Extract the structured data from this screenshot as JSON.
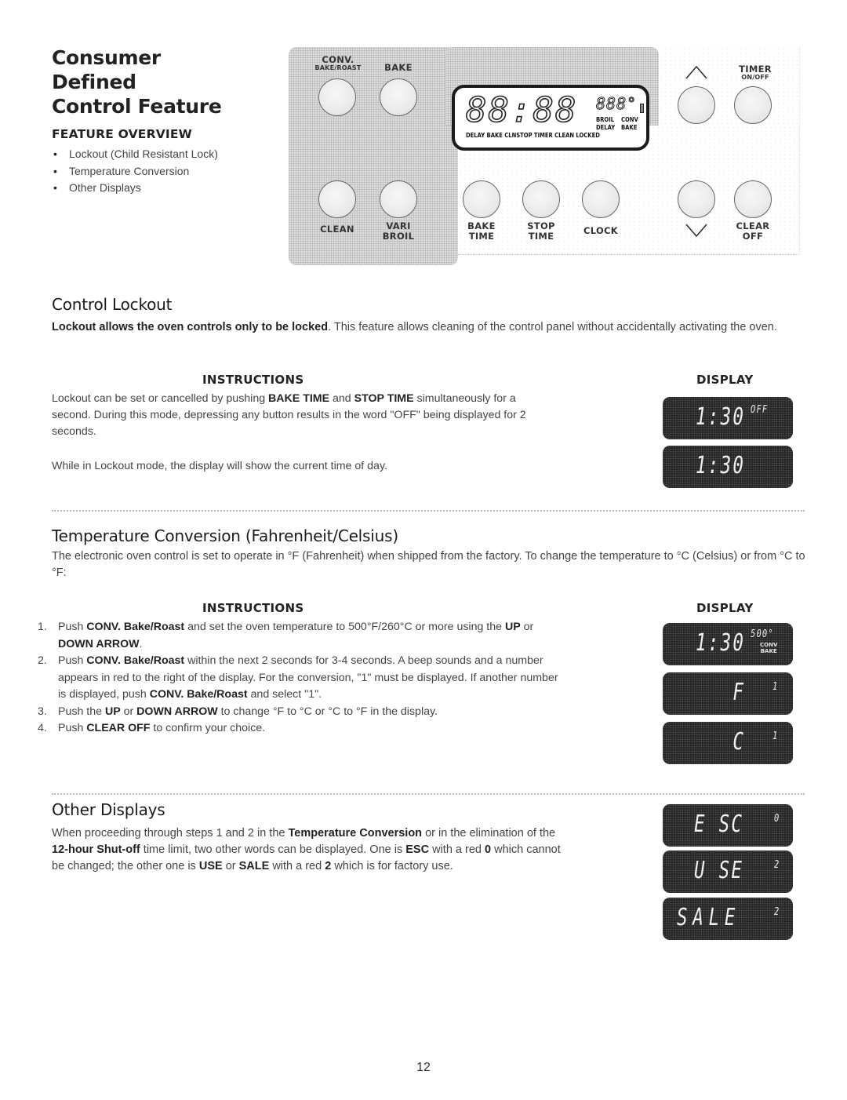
{
  "header": {
    "title_lines": [
      "Consumer",
      "Defined",
      "Control Feature"
    ],
    "overview_heading": "FEATURE OVERVIEW",
    "overview_items": [
      "Lockout (Child Resistant Lock)",
      "Temperature Conversion",
      "Other Displays"
    ]
  },
  "control_panel": {
    "buttons": {
      "conv_bake_roast": {
        "line1": "CONV.",
        "line2": "BAKE/ROAST"
      },
      "bake": {
        "line1": "BAKE"
      },
      "clean": {
        "line1": "CLEAN"
      },
      "vari_broil": {
        "line1": "VARI",
        "line2": "BROIL"
      },
      "bake_time": {
        "line1": "BAKE",
        "line2": "TIME"
      },
      "stop_time": {
        "line1": "STOP",
        "line2": "TIME"
      },
      "clock": {
        "line1": "CLOCK"
      },
      "up_arrow": {
        "icon": "chevron-up-icon"
      },
      "down_arrow": {
        "icon": "chevron-down-icon"
      },
      "timer_on_off": {
        "line1": "TIMER",
        "line2": "ON/OFF"
      },
      "clear_off": {
        "line1": "CLEAR",
        "line2": "OFF"
      }
    },
    "lcd": {
      "main_digits": "88:88",
      "small_digits": "888°",
      "bottom_indicators": "DELAY BAKE CLNSTOP TIMER",
      "right_col1": [
        "BROIL",
        "DELAY",
        "CLEAN"
      ],
      "right_col2": [
        "CONV",
        "BAKE",
        "LOCKED"
      ]
    }
  },
  "control_lockout": {
    "heading": "Control Lockout",
    "intro_bold": "Lockout allows the oven controls only to be locked",
    "intro_rest": ". This feature allows cleaning of the control panel without accidentally activating the oven.",
    "instructions_heading": "INSTRUCTIONS",
    "display_heading": "DISPLAY",
    "instr_p1_a": "Lockout can be set or cancelled by pushing ",
    "instr_p1_b1": "BAKE TIME",
    "instr_p1_c": " and ",
    "instr_p1_b2": "STOP TIME",
    "instr_p1_d": " simultaneously for a second. During this mode, depressing any button results in the word \"OFF\" being displayed for 2 seconds.",
    "instr_p2": "While in Lockout mode, the display will show the current time of day.",
    "displays": [
      {
        "main": "1:30",
        "sup": "OFF"
      },
      {
        "main": "1:30",
        "sup": ""
      }
    ]
  },
  "temperature_conversion": {
    "heading": "Temperature Conversion (Fahrenheit/Celsius)",
    "intro": "The electronic oven control is set to operate in °F (Fahrenheit) when shipped from the factory.  To change the temperature to °C (Celsius) or from °C to °F:",
    "instructions_heading": "INSTRUCTIONS",
    "display_heading": "DISPLAY",
    "steps": [
      {
        "num": "1.",
        "parts": [
          [
            "t",
            "Push "
          ],
          [
            "b",
            "CONV. Bake/Roast"
          ],
          [
            "t",
            " and set the oven temperature to 500°F/260°C or more using the "
          ],
          [
            "b",
            "UP"
          ],
          [
            "t",
            " or "
          ],
          [
            "b",
            "DOWN ARROW"
          ],
          [
            "t",
            "."
          ]
        ]
      },
      {
        "num": "2.",
        "parts": [
          [
            "t",
            "Push "
          ],
          [
            "b",
            "CONV. Bake/Roast"
          ],
          [
            "t",
            " within the next 2 seconds for 3-4 seconds.  A beep sounds and a number appears in red to the right of the display.  For the conversion, \"1\" must be displayed.  If another number is displayed, push "
          ],
          [
            "b",
            "CONV. Bake/Roast"
          ],
          [
            "t",
            " and select \"1\"."
          ]
        ]
      },
      {
        "num": "3.",
        "parts": [
          [
            "t",
            "Push the "
          ],
          [
            "b",
            "UP"
          ],
          [
            "t",
            " or "
          ],
          [
            "b",
            "DOWN ARROW"
          ],
          [
            "t",
            " to change °F to °C or °C to °F in the display."
          ]
        ]
      },
      {
        "num": "4.",
        "parts": [
          [
            "t",
            "Push "
          ],
          [
            "b",
            "CLEAR OFF"
          ],
          [
            "t",
            " to confirm your choice."
          ]
        ]
      }
    ],
    "displays": [
      {
        "main": "1:30",
        "sup": "500°",
        "ind1": "CONV",
        "ind2": "BAKE"
      },
      {
        "main": "   F",
        "sup": "1"
      },
      {
        "main": "   C",
        "sup": "1"
      }
    ]
  },
  "other_displays": {
    "heading": "Other Displays",
    "parts": [
      [
        "t",
        "When proceeding through steps 1 and 2 in the "
      ],
      [
        "b",
        "Temperature Conversion"
      ],
      [
        "t",
        " or in the elimination of the "
      ],
      [
        "b",
        "12-hour Shut-off"
      ],
      [
        "t",
        " time limit, two other words can be displayed. One is "
      ],
      [
        "b",
        "ESC"
      ],
      [
        "t",
        " with a red "
      ],
      [
        "b",
        "0"
      ],
      [
        "t",
        " which cannot be changed; the other one is "
      ],
      [
        "b",
        "USE"
      ],
      [
        "t",
        " or "
      ],
      [
        "b",
        "SALE"
      ],
      [
        "t",
        " with a red "
      ],
      [
        "b",
        "2"
      ],
      [
        "t",
        " which is for factory use."
      ]
    ],
    "displays": [
      {
        "main": "E SC",
        "sup": "0"
      },
      {
        "main": "U SE",
        "sup": "2"
      },
      {
        "main": "SALE",
        "sup": "2"
      }
    ]
  },
  "page_number": "12"
}
